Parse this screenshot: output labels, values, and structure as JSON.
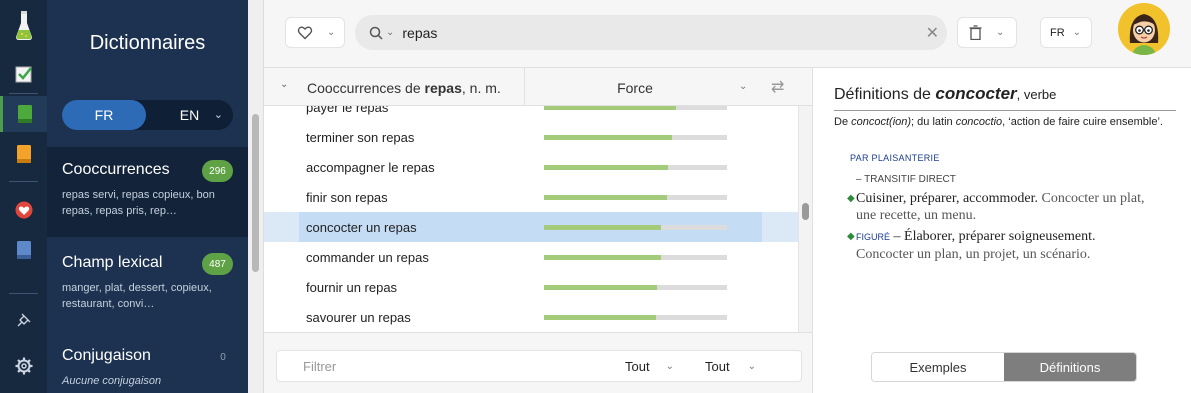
{
  "dictionary": {
    "title": "Dictionnaires",
    "lang_options": [
      "FR",
      "EN"
    ],
    "sections": [
      {
        "title": "Cooccurrences",
        "count": "296",
        "subtitle": "repas servi, repas copieux, bon repas, repas pris, rep…"
      },
      {
        "title": "Champ lexical",
        "count": "487",
        "subtitle": "manger, plat, dessert, copieux, restaurant, convi…"
      },
      {
        "title": "Conjugaison",
        "count": "0",
        "subtitle": "Aucune conjugaison"
      }
    ]
  },
  "toolbar": {
    "search_value": "repas",
    "lang": "FR"
  },
  "list": {
    "header_prefix": "Cooccurrences de ",
    "header_word": "repas",
    "header_suffix": ", n. m.",
    "force_label": "Force",
    "rows": [
      {
        "label": "payer le repas",
        "strength": 0.72
      },
      {
        "label": "terminer son repas",
        "strength": 0.7
      },
      {
        "label": "accompagner le repas",
        "strength": 0.68
      },
      {
        "label": "finir son repas",
        "strength": 0.67
      },
      {
        "label": "concocter un repas",
        "strength": 0.64,
        "selected": true
      },
      {
        "label": "commander un repas",
        "strength": 0.64
      },
      {
        "label": "fournir un repas",
        "strength": 0.62
      },
      {
        "label": "savourer un repas",
        "strength": 0.61
      }
    ]
  },
  "filter": {
    "placeholder": "Filtrer",
    "select1": "Tout",
    "select2": "Tout"
  },
  "definitions": {
    "title_prefix": "Définitions de ",
    "word": "concocter",
    "pos": ", verbe",
    "etym_1": "De ",
    "etym_2": "concoct(ion)",
    "etym_3": "; du latin ",
    "etym_4": "concoctio",
    "etym_5": ", ‘action de faire cuire ensemble’.",
    "register": "PAR PLAISANTERIE",
    "construction": "– TRANSITIF DIRECT",
    "def1": "Cuisiner, préparer, accommoder.",
    "def1_ex": " Concocter un plat, une recette, un menu.",
    "def2_tag": "FIGURÉ",
    "def2": " – Élaborer, préparer soigneusement.",
    "def2_ex": " Concocter un plan, un projet, un scénario.",
    "tab_examples": "Exemples",
    "tab_definitions": "Définitions"
  }
}
